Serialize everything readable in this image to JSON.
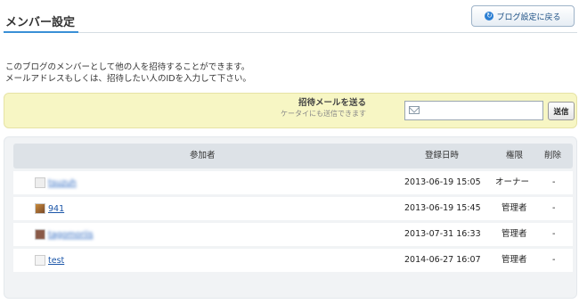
{
  "header": {
    "title": "メンバー設定",
    "back_label": "ブログ設定に戻る"
  },
  "intro": {
    "line1": "このブログのメンバーとして他の人を招待することができます。",
    "line2": "メールアドレスもしくは、招待したい人のIDを入力して下さい。"
  },
  "invite": {
    "title": "招待メールを送る",
    "subtitle": "ケータイにも送信できます",
    "email_value": "",
    "send_label": "送信"
  },
  "table": {
    "headers": {
      "member": "参加者",
      "date": "登録日時",
      "role": "権限",
      "delete": "削除"
    },
    "rows": [
      {
        "name": "tsuzuh",
        "date": "2013-06-19 15:05",
        "role": "オーナー",
        "delete": "-"
      },
      {
        "name": "941",
        "date": "2013-06-19 15:45",
        "role": "管理者",
        "delete": "-"
      },
      {
        "name": "tagomoriis",
        "date": "2013-07-31 16:33",
        "role": "管理者",
        "delete": "-"
      },
      {
        "name": "test",
        "date": "2014-06-27 16:07",
        "role": "管理者",
        "delete": "-"
      }
    ]
  },
  "colors": {
    "accent": "#3a8fd6",
    "invite_bg": "#f7f6c4",
    "link": "#1a55a8"
  }
}
